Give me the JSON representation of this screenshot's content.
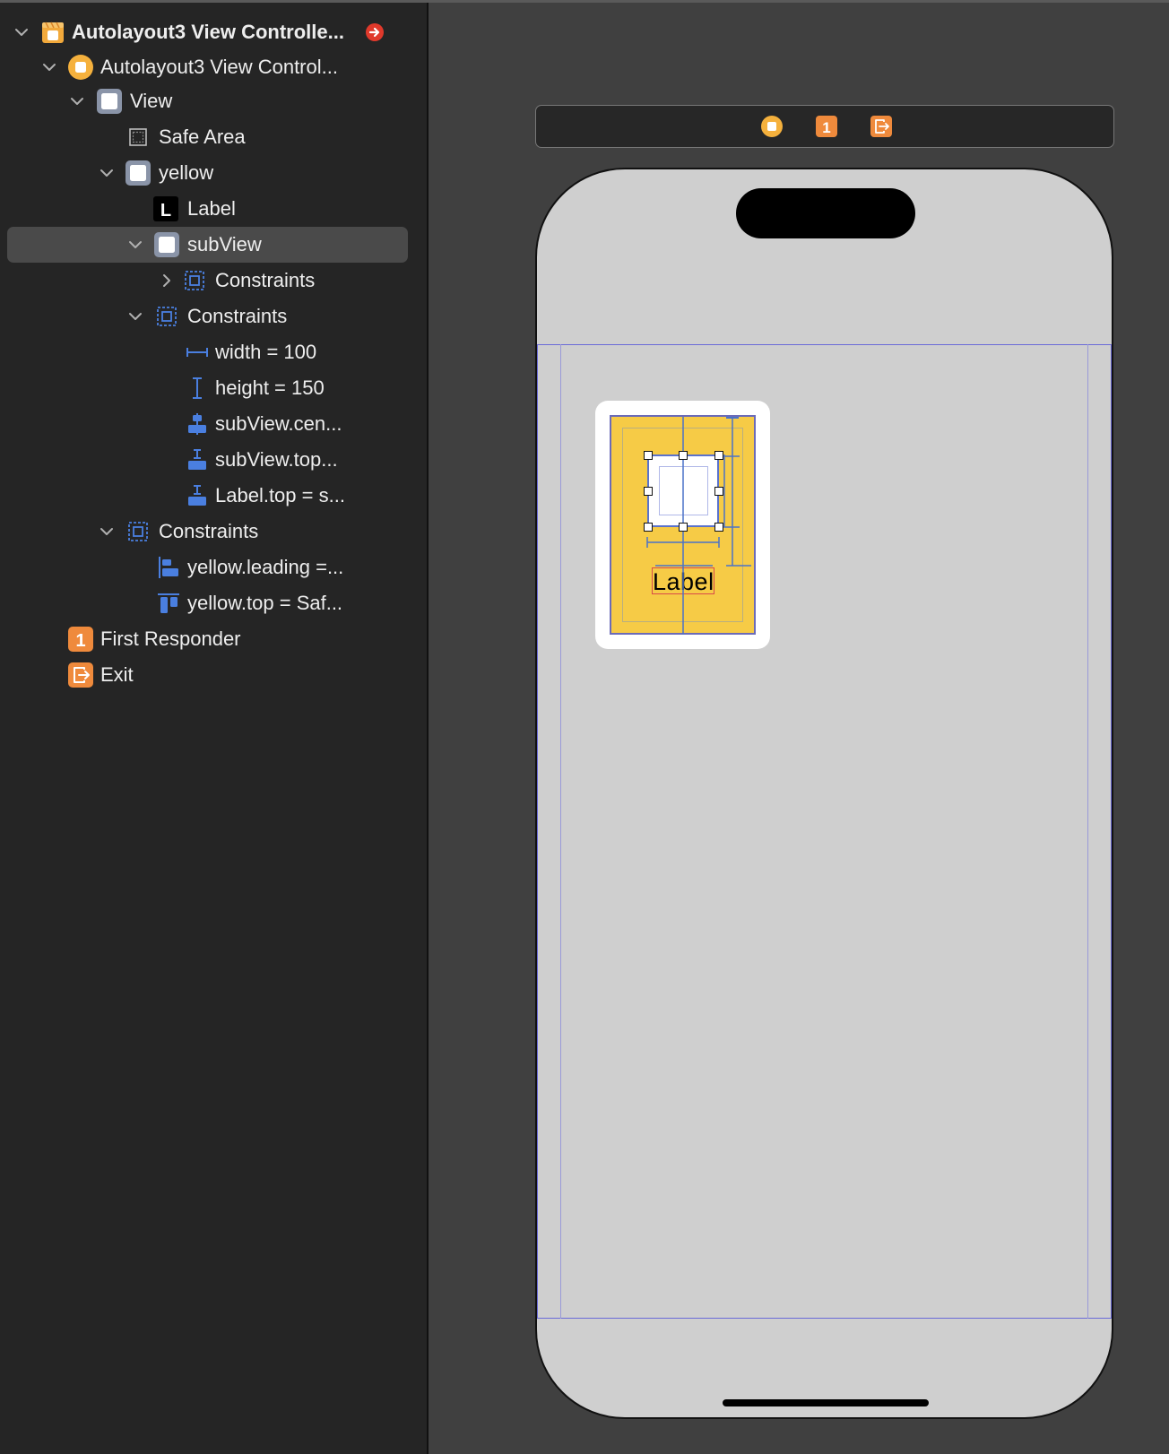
{
  "outline": {
    "items": [
      {
        "label": "Autolayout3 View Controlle...",
        "icon": "scene-icon",
        "chevron": "down",
        "warning": "red-arrow-icon"
      },
      {
        "label": "Autolayout3 View Control...",
        "icon": "view-controller-icon",
        "chevron": "down"
      },
      {
        "label": "View",
        "icon": "view-icon",
        "chevron": "down"
      },
      {
        "label": "Safe Area",
        "icon": "safe-area-icon"
      },
      {
        "label": "yellow",
        "icon": "view-icon",
        "chevron": "down"
      },
      {
        "label": "Label",
        "icon": "label-icon",
        "icon_text": "L"
      },
      {
        "label": "subView",
        "icon": "view-icon",
        "chevron": "down",
        "selected": true
      },
      {
        "label": "Constraints",
        "icon": "constraints-icon",
        "chevron": "right"
      },
      {
        "label": "Constraints",
        "icon": "constraints-icon",
        "chevron": "down"
      },
      {
        "label": "width = 100",
        "icon": "width-constraint-icon"
      },
      {
        "label": "height = 150",
        "icon": "height-constraint-icon"
      },
      {
        "label": "subView.cen...",
        "icon": "center-constraint-icon"
      },
      {
        "label": "subView.top...",
        "icon": "vertical-spacing-constraint-icon"
      },
      {
        "label": "Label.top = s...",
        "icon": "vertical-spacing-constraint-icon"
      },
      {
        "label": "Constraints",
        "icon": "constraints-icon",
        "chevron": "down"
      },
      {
        "label": "yellow.leading =...",
        "icon": "leading-constraint-icon"
      },
      {
        "label": "yellow.top = Saf...",
        "icon": "top-constraint-icon"
      },
      {
        "label": "First Responder",
        "icon": "first-responder-icon",
        "icon_text": "1"
      },
      {
        "label": "Exit",
        "icon": "exit-icon"
      }
    ]
  },
  "scene_toolbar": {
    "icons": [
      "view-controller-icon",
      "first-responder-icon",
      "exit-icon"
    ],
    "first_responder_text": "1"
  },
  "canvas": {
    "label_text": "Label"
  },
  "colors": {
    "outline_bg": "#252525",
    "canvas_bg": "#404040",
    "selection": "#4a4a4a",
    "constraint_blue": "#4a7fe0",
    "orange": "#ef8a3c",
    "yellow_view": "#f6cb46",
    "device": "#cfcfcf",
    "error_red": "#e0392b"
  }
}
